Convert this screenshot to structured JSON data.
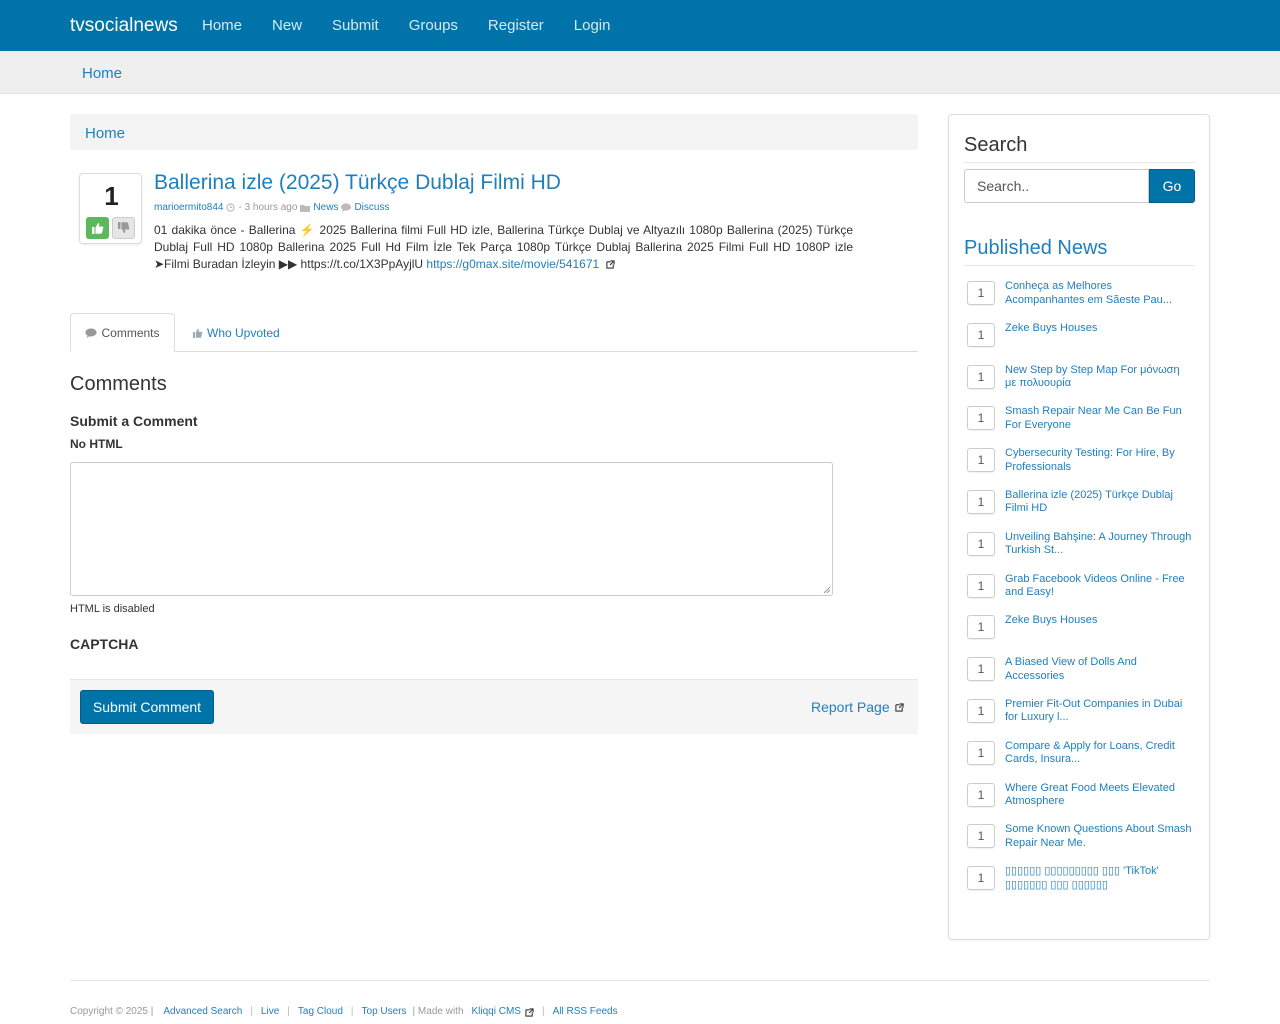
{
  "nav": {
    "brand": "tvsocialnews",
    "links": [
      "Home",
      "New",
      "Submit",
      "Groups",
      "Register",
      "Login"
    ]
  },
  "subbar": {
    "home": "Home"
  },
  "breadcrumb": {
    "home": "Home"
  },
  "story": {
    "votes": "1",
    "title": "Ballerina izle (2025) Türkçe Dublaj Filmi HD",
    "author": "marioermito844",
    "time": "- 3 hours ago",
    "category": "News",
    "discuss": "Discuss",
    "body": "01 dakika önce - Ballerina ⚡ 2025 Ballerina filmi Full HD izle, Ballerina Türkçe Dublaj ve Altyazılı 1080p Ballerina (2025) Türkçe Dublaj Full HD 1080p Ballerina 2025 Full Hd Film İzle Tek Parça 1080p Türkçe Dublaj Ballerina 2025 Filmi Full HD 1080P izle ➤Filmi Buradan İzleyin ▶▶ https://t.co/1X3PpAyjlU",
    "link": "https://g0max.site/movie/541671"
  },
  "tabs": {
    "comments": "Comments",
    "upvoted": "Who Upvoted"
  },
  "comments": {
    "heading": "Comments",
    "submit_heading": "Submit a Comment",
    "no_html": "No HTML",
    "html_disabled": "HTML is disabled",
    "captcha": "CAPTCHA",
    "submit_button": "Submit Comment",
    "report": "Report Page"
  },
  "sidebar": {
    "search_heading": "Search",
    "search_placeholder": "Search..",
    "go": "Go",
    "published_heading": "Published News",
    "news": [
      {
        "count": "1",
        "title": "Conheça as Melhores Acompanhantes em Sãeste Pau..."
      },
      {
        "count": "1",
        "title": "Zeke Buys Houses"
      },
      {
        "count": "1",
        "title": "New Step by Step Map For μόνωση με πολυουρία"
      },
      {
        "count": "1",
        "title": "Smash Repair Near Me Can Be Fun For Everyone"
      },
      {
        "count": "1",
        "title": "Cybersecurity Testing: For Hire, By Professionals"
      },
      {
        "count": "1",
        "title": "Ballerina izle (2025) Türkçe Dublaj Filmi HD"
      },
      {
        "count": "1",
        "title": "Unveiling Bahşine: A Journey Through Turkish St..."
      },
      {
        "count": "1",
        "title": "Grab Facebook Videos Online - Free and Easy!"
      },
      {
        "count": "1",
        "title": "Zeke Buys Houses"
      },
      {
        "count": "1",
        "title": "A Biased View of Dolls And Accessories"
      },
      {
        "count": "1",
        "title": "Premier Fit-Out Companies in Dubai for Luxury l..."
      },
      {
        "count": "1",
        "title": "Compare & Apply for Loans, Credit Cards, Insura..."
      },
      {
        "count": "1",
        "title": "Where Great Food Meets Elevated Atmosphere"
      },
      {
        "count": "1",
        "title": "Some Known Questions About Smash Repair Near Me."
      },
      {
        "count": "1",
        "title": "▯▯▯▯▯▯ ▯▯▯▯▯▯▯▯▯ ▯▯▯ 'TikTok' ▯▯▯▯▯▯▯ ▯▯▯ ▯▯▯▯▯▯"
      }
    ]
  },
  "footer": {
    "copyright": "Copyright © 2025 |",
    "links": [
      "Advanced Search",
      "Live",
      "Tag Cloud",
      "Top Users"
    ],
    "made_with": "| Made with",
    "cms": "Kliqqi CMS",
    "rss": "All RSS Feeds"
  },
  "colors": {
    "nav_bg": "#0074a8",
    "link": "#1f7fbd",
    "upvote": "#5cb85c"
  }
}
